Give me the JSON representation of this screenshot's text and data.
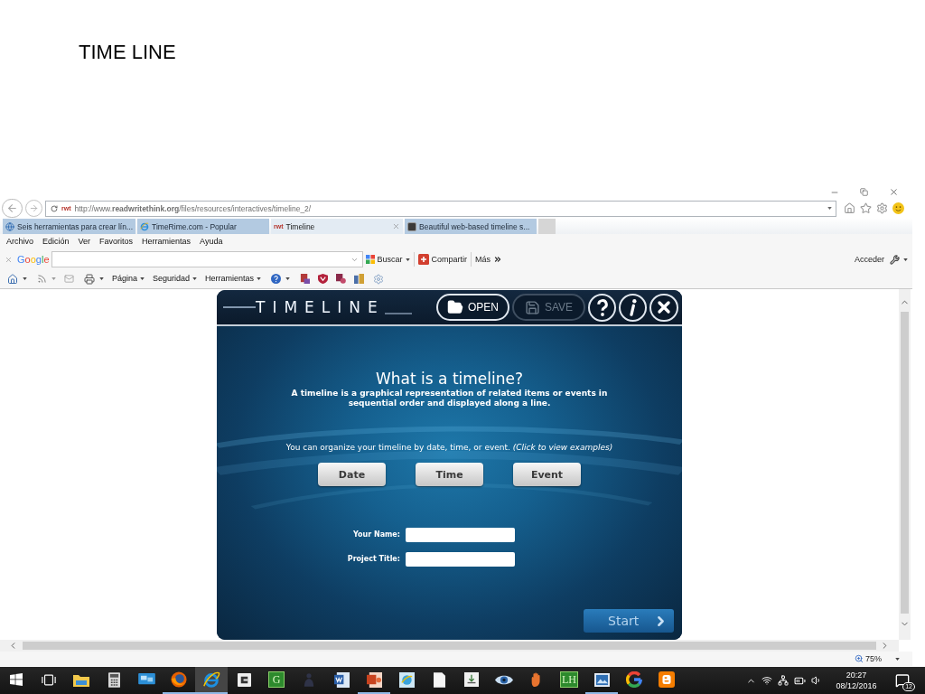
{
  "slide_title": "TIME LINE",
  "browser": {
    "address": {
      "favicon": "rwt",
      "url": "http://www.**readwritethink.org**/files/resources/interactives/timeline_2/"
    },
    "tabs": [
      {
        "title": "Seis herramientas para crear lín...",
        "kind": "globe",
        "selected": false
      },
      {
        "title": "TimeRime.com - Popular",
        "kind": "ie",
        "selected": false
      },
      {
        "title": "Timeline",
        "kind": "text",
        "favicon": "rwt",
        "selected": true
      },
      {
        "title": "Beautiful web-based timeline s...",
        "kind": "square",
        "selected": false
      }
    ],
    "menu": [
      "Archivo",
      "Edición",
      "Ver",
      "Favoritos",
      "Herramientas",
      "Ayuda"
    ],
    "google_toolbar": {
      "logo": "Google",
      "buttons": [
        {
          "label": "Buscar",
          "kind": "search"
        },
        {
          "label": "Compartir",
          "kind": "share"
        },
        {
          "label": "Más",
          "kind": "more"
        }
      ],
      "account": "Acceder"
    },
    "command_bar": {
      "menus": [
        "Página",
        "Seguridad",
        "Herramientas"
      ]
    },
    "status_bar": {
      "zoom": "75%"
    }
  },
  "app": {
    "logo": "TIMELINE",
    "toolbar": [
      {
        "label": "OPEN",
        "kind": "open",
        "disabled": false
      },
      {
        "label": "SAVE",
        "kind": "save",
        "disabled": true
      }
    ],
    "heading": "What is a timeline?",
    "description": "A timeline is a graphical representation of related items or events in sequential order and displayed along a line.",
    "prompt": "You can organize your timeline by date, time, or event. *(Click to view examples)*",
    "types": [
      "Date",
      "Time",
      "Event"
    ],
    "fields": [
      {
        "label": "Your Name:"
      },
      {
        "label": "Project Title:"
      }
    ],
    "start": "Start"
  },
  "taskbar": {
    "apps": [
      {
        "kind": "start",
        "selected": false,
        "running": false
      },
      {
        "kind": "taskview",
        "selected": false,
        "running": false
      },
      {
        "kind": "folder",
        "selected": false,
        "running": false
      },
      {
        "kind": "calculator",
        "selected": false,
        "running": false
      },
      {
        "kind": "monitor",
        "selected": false,
        "running": false
      },
      {
        "kind": "firefox",
        "selected": false,
        "running": true
      },
      {
        "kind": "ie",
        "selected": true,
        "running": true
      },
      {
        "kind": "tile",
        "selected": false,
        "running": false
      },
      {
        "kind": "letter",
        "label": "G",
        "selected": false,
        "running": false
      },
      {
        "kind": "figure",
        "selected": false,
        "running": false
      },
      {
        "kind": "document",
        "selected": false,
        "running": false
      },
      {
        "kind": "slides",
        "selected": false,
        "running": true
      },
      {
        "kind": "globe",
        "selected": false,
        "running": false
      },
      {
        "kind": "page",
        "selected": false,
        "running": false
      },
      {
        "kind": "box",
        "selected": false,
        "running": false
      },
      {
        "kind": "eye",
        "selected": false,
        "running": false
      },
      {
        "kind": "hand",
        "selected": false,
        "running": false
      },
      {
        "kind": "letter",
        "label": "LH",
        "selected": false,
        "running": false
      },
      {
        "kind": "picture",
        "selected": false,
        "running": true
      },
      {
        "kind": "google",
        "selected": false,
        "running": false
      },
      {
        "kind": "blogger",
        "selected": false,
        "running": false
      }
    ],
    "clock": {
      "time": "20:27",
      "date": "08/12/2016"
    },
    "notifications": "12"
  }
}
